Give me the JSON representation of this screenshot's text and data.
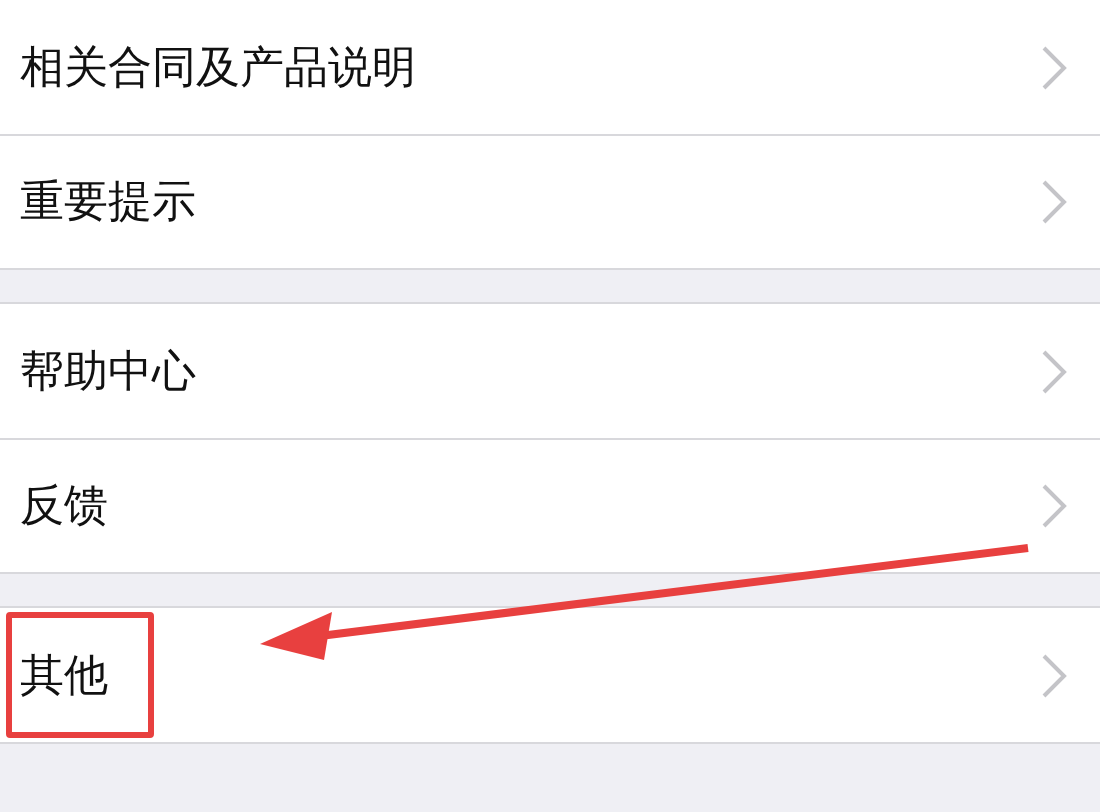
{
  "groups": [
    {
      "items": [
        {
          "label": "相关合同及产品说明",
          "highlighted": false
        },
        {
          "label": "重要提示",
          "highlighted": false
        }
      ]
    },
    {
      "items": [
        {
          "label": "帮助中心",
          "highlighted": false
        },
        {
          "label": "反馈",
          "highlighted": false
        }
      ]
    },
    {
      "items": [
        {
          "label": "其他",
          "highlighted": true
        }
      ]
    }
  ]
}
